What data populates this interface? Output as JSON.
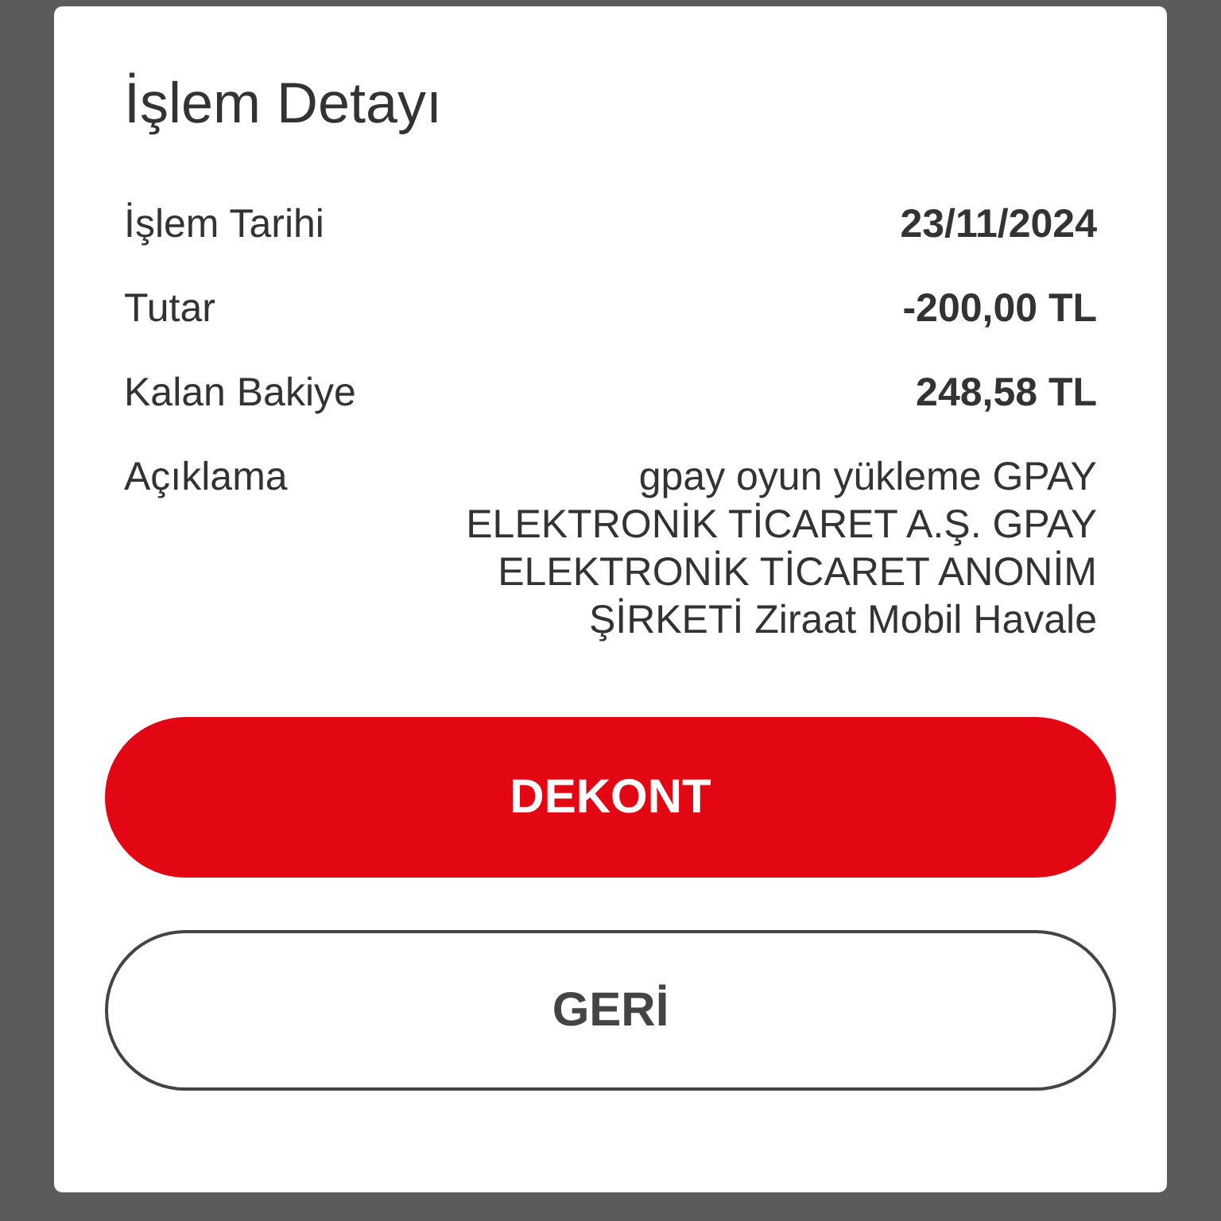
{
  "dialog": {
    "title": "İşlem Detayı",
    "rows": [
      {
        "label": "İşlem Tarihi",
        "value": "23/11/2024",
        "kind": "bold"
      },
      {
        "label": "Tutar",
        "value": "-200,00 TL",
        "kind": "bold"
      },
      {
        "label": "Kalan Bakiye",
        "value": "248,58 TL",
        "kind": "bold"
      },
      {
        "label": "Açıklama",
        "value": "gpay oyun yükleme GPAY ELEKTRONİK TİCARET A.Ş. GPAY ELEKTRONİK TİCARET ANONİM ŞİRKETİ Ziraat Mobil Havale",
        "kind": "plain"
      }
    ],
    "buttons": [
      {
        "label": "DEKONT",
        "kind": "primary"
      },
      {
        "label": "GERİ",
        "kind": "secondary"
      }
    ]
  }
}
